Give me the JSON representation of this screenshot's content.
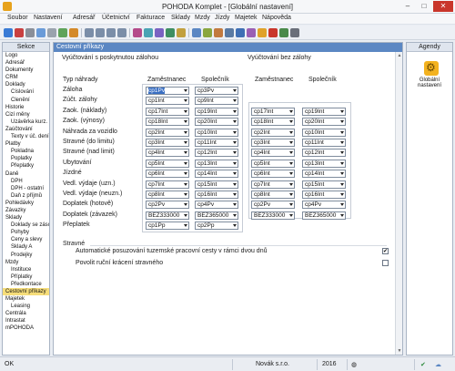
{
  "window": {
    "title": "POHODA Komplet - [Globální nastavení]",
    "minimize": "–",
    "maximize": "□",
    "close": "✕"
  },
  "menu": [
    "Soubor",
    "Nastavení",
    "Adresář",
    "Účetnictví",
    "Fakturace",
    "Sklady",
    "Mzdy",
    "Jízdy",
    "Majetek",
    "Nápověda"
  ],
  "sidebar": {
    "title": "Sekce",
    "items": [
      {
        "label": "Logo",
        "level": 1
      },
      {
        "label": "Adresář",
        "level": 1
      },
      {
        "label": "Dokumenty",
        "level": 1
      },
      {
        "label": "CRM",
        "level": 1
      },
      {
        "label": "Doklady",
        "level": 1
      },
      {
        "label": "Číslování",
        "level": 2
      },
      {
        "label": "Členění",
        "level": 2
      },
      {
        "label": "Historie",
        "level": 1
      },
      {
        "label": "Cizí měny",
        "level": 1
      },
      {
        "label": "Uzávěrka kurz. rozdílů",
        "level": 2
      },
      {
        "label": "Zaúčtování",
        "level": 1
      },
      {
        "label": "Texty v úč. deníku",
        "level": 2
      },
      {
        "label": "Platby",
        "level": 1
      },
      {
        "label": "Pokladna",
        "level": 2
      },
      {
        "label": "Poplatky",
        "level": 2
      },
      {
        "label": "Přeplatky",
        "level": 2
      },
      {
        "label": "Daně",
        "level": 1
      },
      {
        "label": "DPH",
        "level": 2
      },
      {
        "label": "DPH - ostatní",
        "level": 2
      },
      {
        "label": "Daň z příjmů",
        "level": 2
      },
      {
        "label": "Pohledávky",
        "level": 1
      },
      {
        "label": "Závazky",
        "level": 1
      },
      {
        "label": "Sklady",
        "level": 1
      },
      {
        "label": "Doklady se zásobami",
        "level": 2
      },
      {
        "label": "Pohyby",
        "level": 2
      },
      {
        "label": "Ceny a slevy",
        "level": 2
      },
      {
        "label": "Sklady A",
        "level": 2
      },
      {
        "label": "Prodejky",
        "level": 2
      },
      {
        "label": "Mzdy",
        "level": 1
      },
      {
        "label": "Instituce",
        "level": 2
      },
      {
        "label": "Příplatky",
        "level": 2
      },
      {
        "label": "Předkontace",
        "level": 2
      },
      {
        "label": "Cestovní příkazy",
        "level": 1,
        "selected": true
      },
      {
        "label": "Majetek",
        "level": 1
      },
      {
        "label": "Leasing",
        "level": 2
      },
      {
        "label": "Centrála",
        "level": 1
      },
      {
        "label": "Intrastat",
        "level": 1
      },
      {
        "label": "mPOHODA",
        "level": 1
      }
    ]
  },
  "main": {
    "title": "Cestovní příkazy",
    "section_zaloha": "Vyúčtování s poskytnutou zálohou",
    "section_bez": "Vyúčtování bez zálohy",
    "typ_nahrady": "Typ náhrady",
    "col_zamestnanec": "Zaměstnanec",
    "col_spolecnik": "Společník",
    "rows": [
      "Záloha",
      "Zúčt. zálohy",
      "Zaok. (náklady)",
      "Zaok. (výnosy)",
      "Náhrada za vozidlo",
      "Stravné (do limitu)",
      "Stravné (nad limit)",
      "Ubytování",
      "Jízdné",
      "Vedl. výdaje (uzn.)",
      "Vedl. výdaje (neuzn.)",
      "Doplatek (hotově)",
      "Doplatek (závazek)",
      "Přeplatek"
    ],
    "zaloha_zam": [
      "cp1Pv",
      "cp1Int",
      "cp17Int",
      "cp18Int",
      "cp2Int",
      "cp3Int",
      "cp4Int",
      "cp5Int",
      "cp6Int",
      "cp7Int",
      "cp8Int",
      "cp2Pv",
      "BEZ333000",
      "cp1Pp"
    ],
    "zaloha_spol": [
      "cp3Pv",
      "cp9Int",
      "cp19Int",
      "cp20Int",
      "cp10Int",
      "cp11Int",
      "cp12Int",
      "cp13Int",
      "cp14Int",
      "cp15Int",
      "cp16Int",
      "cp4Pv",
      "BEZ365000",
      "cp2Pp"
    ],
    "bez_zam": [
      "cp17Int",
      "cp18Int",
      "cp2Int",
      "cp3Int",
      "cp4Int",
      "cp5Int",
      "cp6Int",
      "cp7Int",
      "cp8Int",
      "cp2Pv",
      "BEZ333000"
    ],
    "bez_spol": [
      "cp19Int",
      "cp20Int",
      "cp10Int",
      "cp11Int",
      "cp12Int",
      "cp13Int",
      "cp14Int",
      "cp15Int",
      "cp16Int",
      "cp4Pv",
      "BEZ365000"
    ],
    "stravne_title": "Stravné",
    "check_auto_label": "Automatické posuzování tuzemské pracovní cesty v rámci dvou dnů",
    "check_auto_value": "✔",
    "check_rucni_label": "Povolit ruční krácení stravného",
    "check_rucni_value": ""
  },
  "agendy": {
    "title": "Agendy",
    "item_label": "Globální nastavení",
    "item_icon": "gear-icon"
  },
  "status": {
    "ok": "OK",
    "company": "Novák s.r.o.",
    "year": "2016",
    "accent": "#5b87c3"
  }
}
